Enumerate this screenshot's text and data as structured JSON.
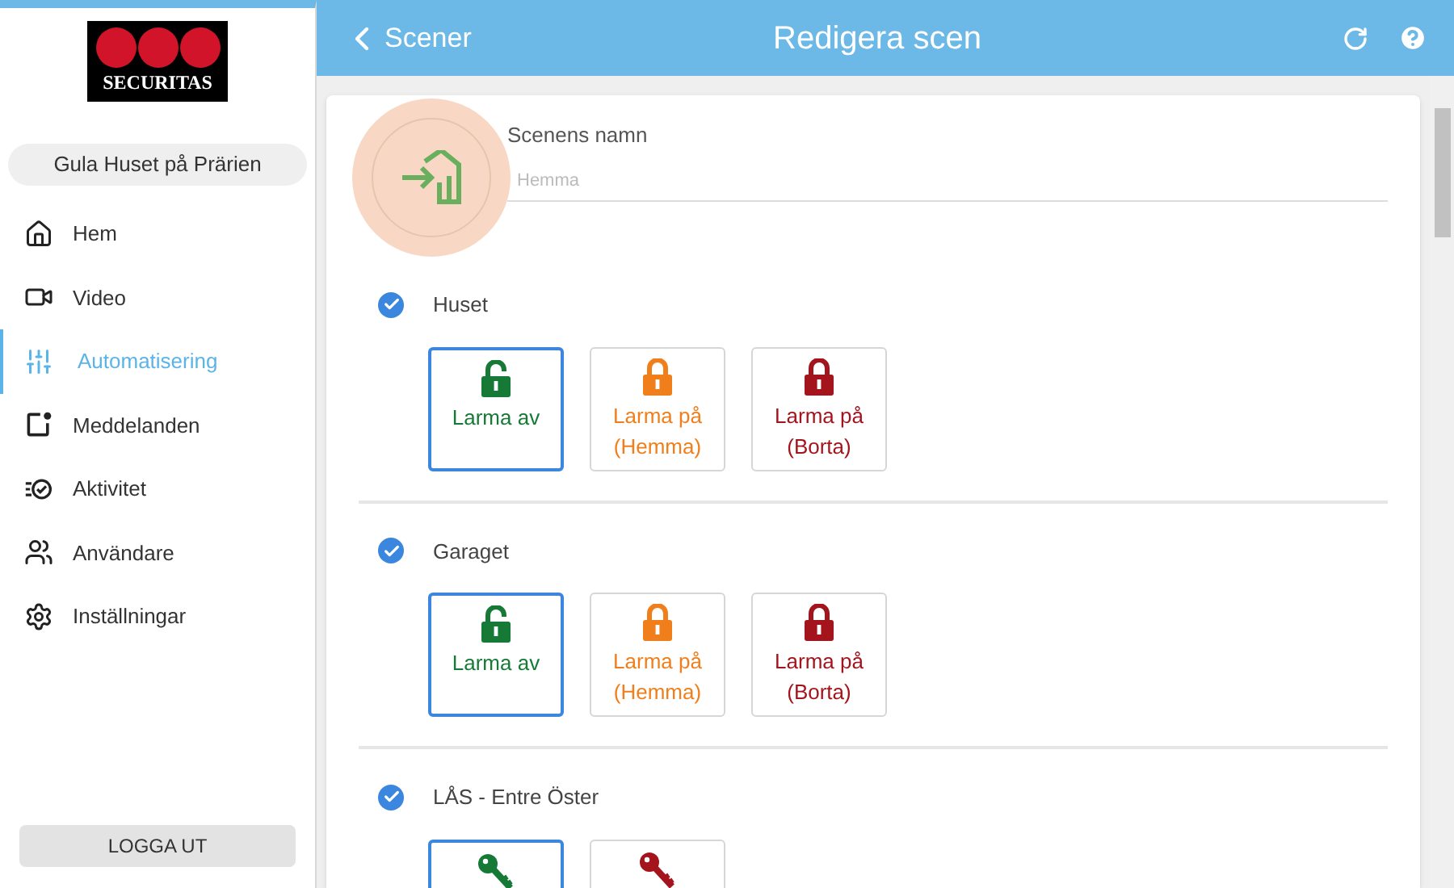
{
  "sidebar": {
    "logo_text": "SECURITAS",
    "site": "Gula Huset på Prärien",
    "items": [
      {
        "label": "Hem",
        "selected": false
      },
      {
        "label": "Video",
        "selected": false
      },
      {
        "label": "Automatisering",
        "selected": true
      },
      {
        "label": "Meddelanden",
        "selected": false
      },
      {
        "label": "Aktivitet",
        "selected": false
      },
      {
        "label": "Användare",
        "selected": false
      },
      {
        "label": "Inställningar",
        "selected": false
      }
    ],
    "logout": "LOGGA UT"
  },
  "header": {
    "back": "Scener",
    "title": "Redigera scen"
  },
  "scene": {
    "name_label": "Scenens namn",
    "placeholder": "Hemma"
  },
  "groups": [
    {
      "name": "Huset",
      "checked": true,
      "options": [
        {
          "kind": "alarm_off",
          "label": "Larma av",
          "selected": true
        },
        {
          "kind": "alarm_home",
          "label": "Larma på (Hemma)",
          "selected": false
        },
        {
          "kind": "alarm_away",
          "label": "Larma på (Borta)",
          "selected": false
        }
      ]
    },
    {
      "name": "Garaget",
      "checked": true,
      "options": [
        {
          "kind": "alarm_off",
          "label": "Larma av",
          "selected": true
        },
        {
          "kind": "alarm_home",
          "label": "Larma på (Hemma)",
          "selected": false
        },
        {
          "kind": "alarm_away",
          "label": "Larma på (Borta)",
          "selected": false
        }
      ]
    },
    {
      "name": "LÅS - Entre Öster",
      "checked": true,
      "options": [
        {
          "kind": "unlock",
          "selected": true
        },
        {
          "kind": "lock",
          "selected": false
        }
      ]
    }
  ]
}
